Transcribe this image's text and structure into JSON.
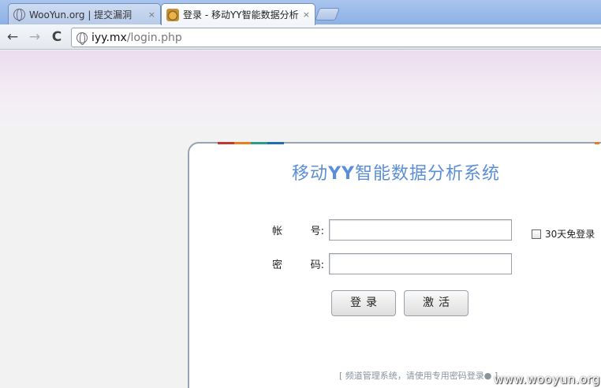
{
  "browser": {
    "tabs": [
      {
        "label": "WooYun.org | 提交漏洞",
        "close": "×"
      },
      {
        "label": "登录 - 移动YY智能数据分析",
        "close": "×"
      }
    ],
    "nav": {
      "back": "←",
      "forward": "→",
      "reload": "C"
    },
    "address": {
      "host": "iyy.mx",
      "path": "/login.php"
    }
  },
  "login": {
    "title_prefix": "移动",
    "title_yy": "YY",
    "title_suffix": "智能数据分析系统",
    "account_label_a": "帐",
    "account_label_b": "号:",
    "password_label_a": "密",
    "password_label_b": "码:",
    "account_value": "",
    "password_value": "",
    "remember_label": "30天免登录",
    "login_button": "登录",
    "activate_button": "激活",
    "footer_note": "[ 频道管理系统，请使用专用密码登录● ]"
  },
  "colors": {
    "accent": "#5b8ed6",
    "stripe": [
      "#c0392b",
      "#e67e22",
      "#2a9d8f",
      "#1f6fb2"
    ]
  },
  "watermark": "www.wooyun.org"
}
